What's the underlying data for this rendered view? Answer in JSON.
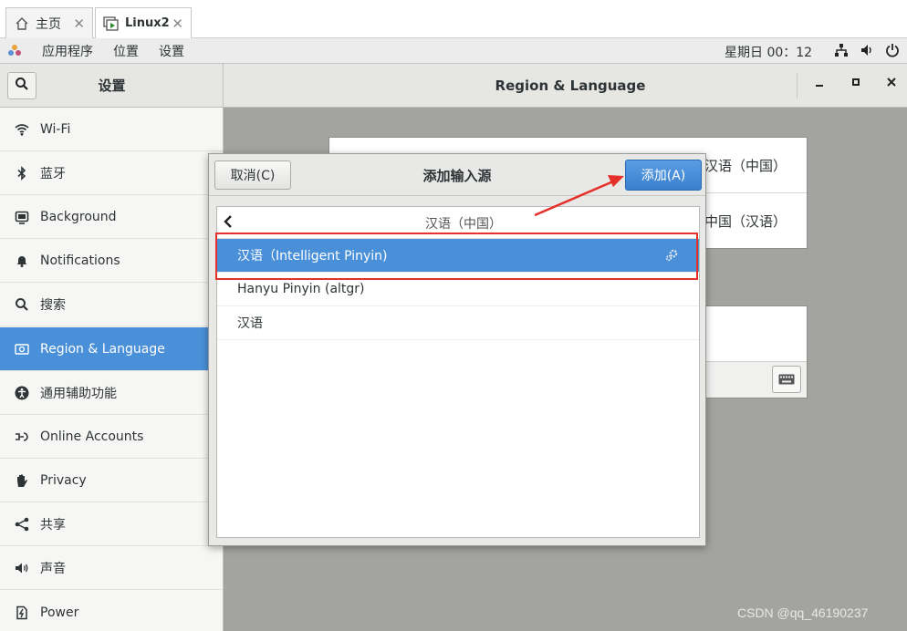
{
  "vm_tabs": [
    {
      "label": "主页",
      "icon": "home-icon"
    },
    {
      "label": "Linux2",
      "icon": "vm-icon"
    }
  ],
  "topbar": {
    "apps": "应用程序",
    "places": "位置",
    "settings": "设置",
    "clock": "星期日 00：12",
    "tray_icons": [
      "network-icon",
      "volume-icon",
      "power-icon"
    ]
  },
  "settings": {
    "sidebar_title": "设置",
    "panel_title": "Region & Language",
    "sidebar": [
      {
        "label": "Wi-Fi",
        "icon": "wifi-icon"
      },
      {
        "label": "蓝牙",
        "icon": "bluetooth-icon"
      },
      {
        "label": "Background",
        "icon": "background-icon"
      },
      {
        "label": "Notifications",
        "icon": "bell-icon"
      },
      {
        "label": "搜索",
        "icon": "search-icon"
      },
      {
        "label": "Region & Language",
        "icon": "region-icon",
        "active": true
      },
      {
        "label": "通用辅助功能",
        "icon": "accessibility-icon"
      },
      {
        "label": "Online Accounts",
        "icon": "online-accounts-icon"
      },
      {
        "label": "Privacy",
        "icon": "hand-icon"
      },
      {
        "label": "共享",
        "icon": "share-icon"
      },
      {
        "label": "声音",
        "icon": "speaker-icon"
      },
      {
        "label": "Power",
        "icon": "power-icon"
      }
    ],
    "language_rows": [
      "汉语（中国）",
      "中国（汉语）"
    ]
  },
  "dialog": {
    "title": "添加输入源",
    "cancel_label": "取消(C)",
    "add_label": "添加(A)",
    "breadcrumb": "汉语（中国）",
    "options": [
      {
        "label": "汉语（Intelligent Pinyin)",
        "selected": true,
        "has_settings": true
      },
      {
        "label": "Hanyu Pinyin (altgr)",
        "selected": false
      },
      {
        "label": "汉语",
        "selected": false
      }
    ]
  },
  "annotation": {
    "color": "#e5302a"
  },
  "colors": {
    "accent": "#4a90d9"
  },
  "watermark": "CSDN @qq_46190237"
}
